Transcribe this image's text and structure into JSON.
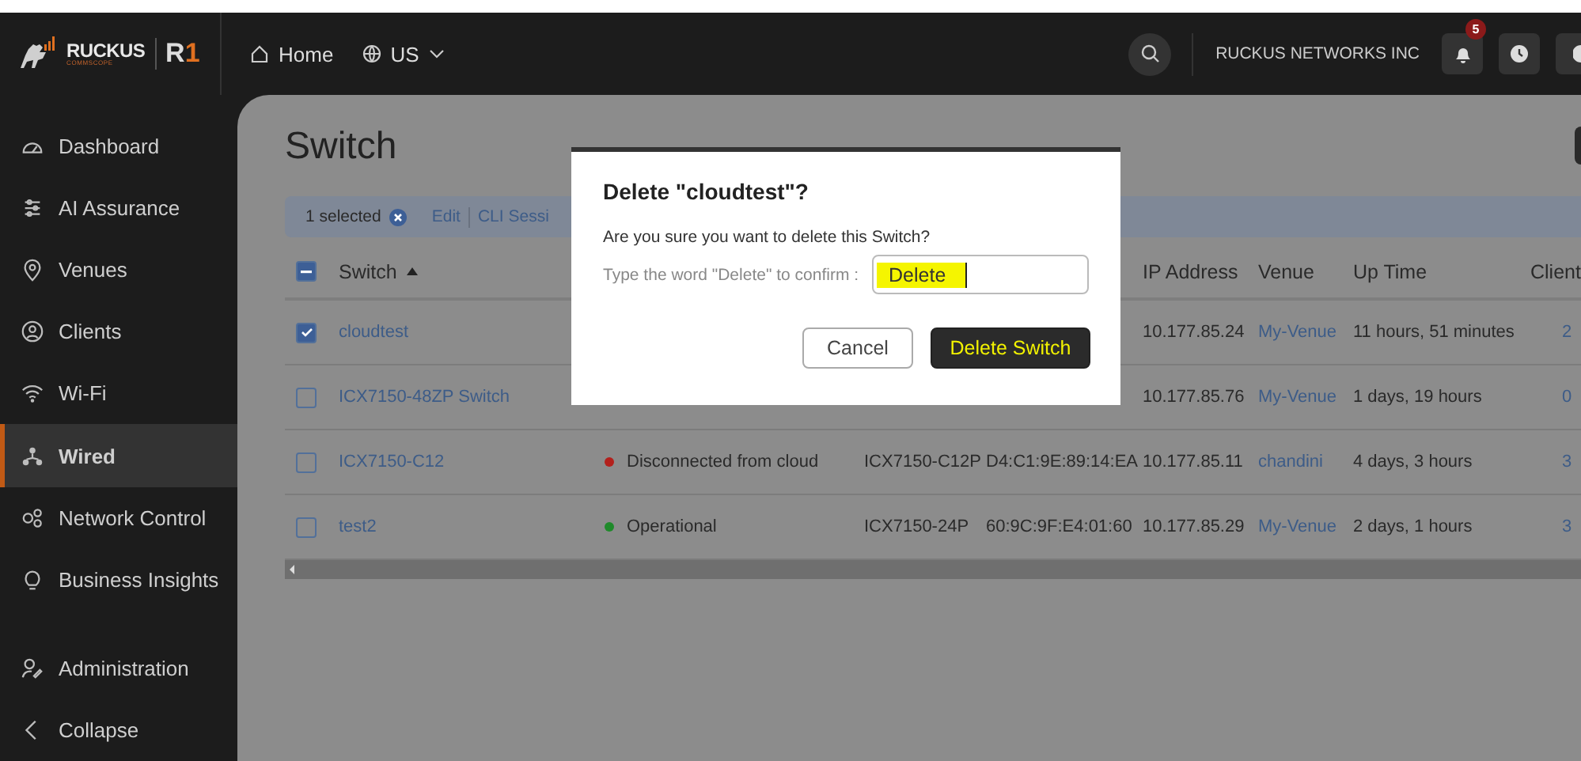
{
  "header": {
    "logo": {
      "brand": "RUCKUS",
      "sub": "COMMSCOPE",
      "product_letter": "R",
      "product_number": "1"
    },
    "home": "Home",
    "region": "US",
    "account": "RUCKUS NETWORKS INC",
    "notification_count": "5"
  },
  "sidebar": {
    "items": [
      {
        "label": "Dashboard",
        "selected": false
      },
      {
        "label": "AI Assurance",
        "selected": false
      },
      {
        "label": "Venues",
        "selected": false
      },
      {
        "label": "Clients",
        "selected": false
      },
      {
        "label": "Wi-Fi",
        "selected": false
      },
      {
        "label": "Wired",
        "selected": true
      },
      {
        "label": "Network Control",
        "selected": false
      },
      {
        "label": "Business Insights",
        "selected": false
      },
      {
        "label": "Administration",
        "selected": false
      }
    ],
    "collapse": "Collapse"
  },
  "page": {
    "title": "Switch",
    "toolbar": {
      "selected_count": "1 selected",
      "actions": [
        "Edit",
        "CLI Sessi"
      ]
    },
    "table": {
      "select_all": {
        "indeterminate": true
      },
      "columns": [
        {
          "label": "Switch",
          "sorted": true
        },
        {
          "label": "IP Address"
        },
        {
          "label": "Venue"
        },
        {
          "label": "Up Time"
        },
        {
          "label": "Client"
        }
      ],
      "rows": [
        {
          "checked": true,
          "name": "cloudtest",
          "ip": "10.177.85.24",
          "venue": "My-Venue",
          "uptime": "11 hours, 51 minutes",
          "clients": "2"
        },
        {
          "checked": false,
          "name": "ICX7150-48ZP Switch",
          "ip": "10.177.85.76",
          "venue": "My-Venue",
          "uptime": "1 days, 19 hours",
          "clients": "0"
        },
        {
          "checked": false,
          "name": "ICX7150-C12",
          "status": {
            "text": "Disconnected from cloud",
            "color": "#b3201c"
          },
          "model": "ICX7150-C12P",
          "mac": "D4:C1:9E:89:14:EA",
          "ip": "10.177.85.11",
          "venue": "chandini",
          "uptime": "4 days, 3 hours",
          "clients": "3"
        },
        {
          "checked": false,
          "name": "test2",
          "status": {
            "text": "Operational",
            "color": "#1f8a2a"
          },
          "model": "ICX7150-24P",
          "mac": "60:9C:9F:E4:01:60",
          "ip": "10.177.85.29",
          "venue": "My-Venue",
          "uptime": "2 days, 1 hours",
          "clients": "3"
        }
      ]
    }
  },
  "dialog": {
    "title": "Delete \"cloudtest\"?",
    "message": "Are you sure you want to delete this Switch?",
    "confirm_label": "Type the word \"Delete\" to confirm :",
    "confirm_value": "Delete",
    "buttons": [
      {
        "label": "Cancel",
        "kind": "secondary"
      },
      {
        "label": "Delete Switch",
        "kind": "primary"
      }
    ]
  }
}
